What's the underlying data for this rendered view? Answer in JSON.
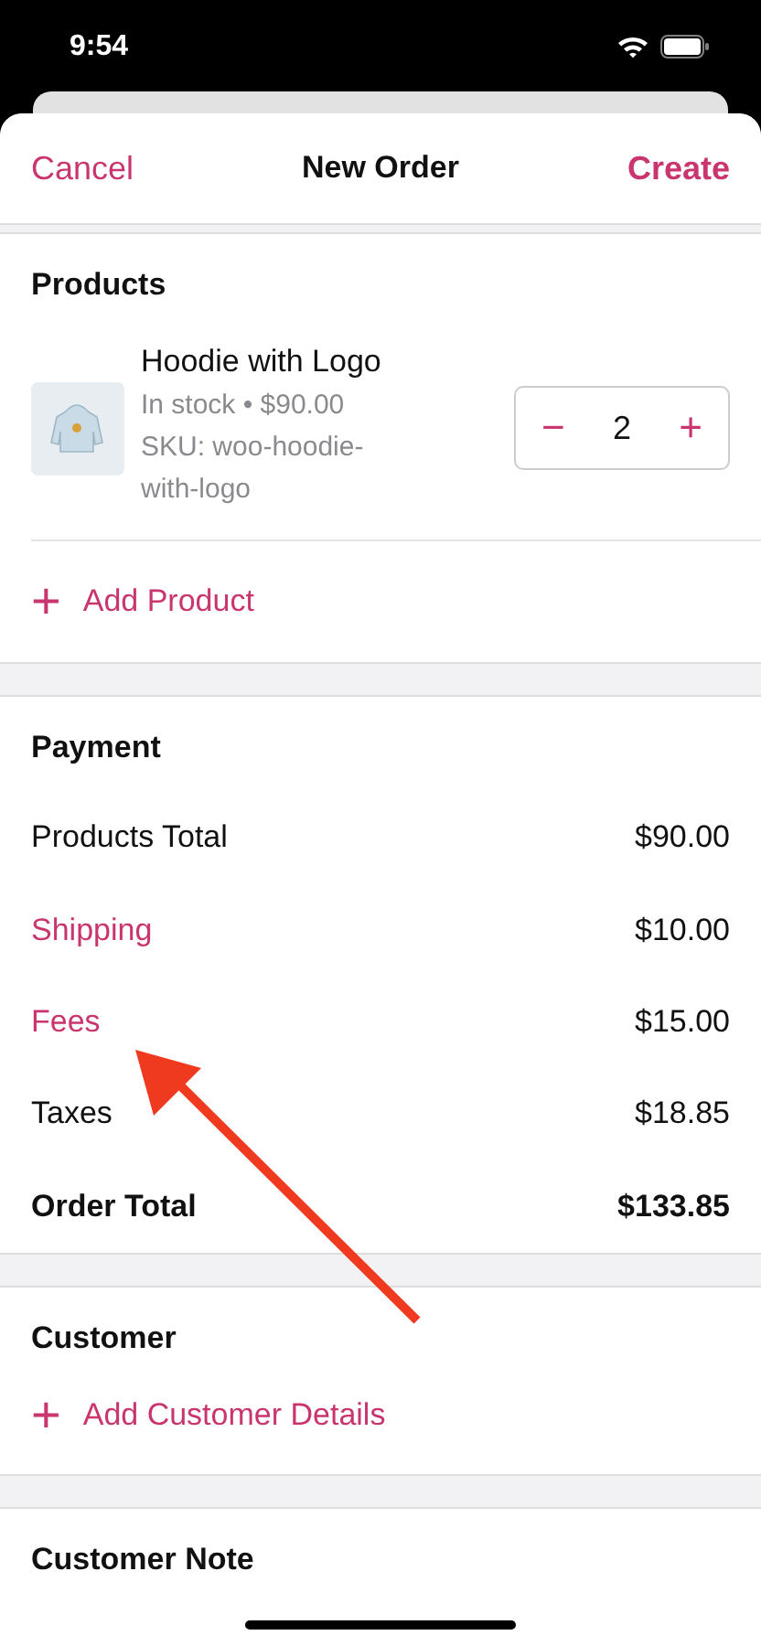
{
  "status_bar": {
    "time": "9:54"
  },
  "nav": {
    "cancel": "Cancel",
    "title": "New Order",
    "create": "Create"
  },
  "products": {
    "title": "Products",
    "items": [
      {
        "name": "Hoodie with Logo",
        "stock": "In stock • $90.00",
        "sku": "SKU: woo-hoodie-with-logo",
        "quantity": "2",
        "minus": "−",
        "plus": "+"
      }
    ],
    "add": {
      "icon": "+",
      "label": "Add Product"
    }
  },
  "payment": {
    "title": "Payment",
    "rows": [
      {
        "label": "Products Total",
        "value": "$90.00",
        "kind": "plain"
      },
      {
        "label": "Shipping",
        "value": "$10.00",
        "kind": "link"
      },
      {
        "label": "Fees",
        "value": "$15.00",
        "kind": "link"
      },
      {
        "label": "Taxes",
        "value": "$18.85",
        "kind": "plain"
      },
      {
        "label": "Order Total",
        "value": "$133.85",
        "kind": "total"
      }
    ]
  },
  "customer": {
    "title": "Customer",
    "add": {
      "icon": "+",
      "label": "Add Customer Details"
    }
  },
  "customer_note": {
    "title": "Customer Note"
  }
}
